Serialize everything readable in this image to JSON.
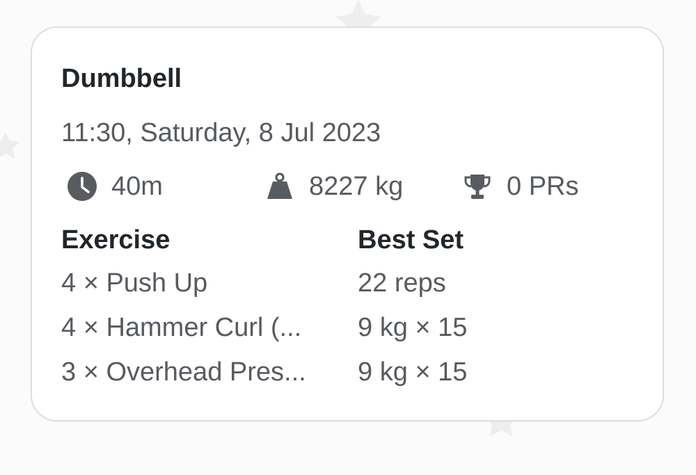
{
  "workout": {
    "title": "Dumbbell",
    "datetime": "11:30, Saturday, 8 Jul 2023"
  },
  "stats": {
    "duration": "40m",
    "volume": "8227 kg",
    "prs": "0 PRs"
  },
  "table": {
    "headers": {
      "exercise": "Exercise",
      "best_set": "Best Set"
    },
    "rows": [
      {
        "exercise": "4 × Push Up",
        "best_set": "22 reps"
      },
      {
        "exercise": "4 × Hammer Curl (...",
        "best_set": "9 kg × 15"
      },
      {
        "exercise": "3 × Overhead Pres...",
        "best_set": "9 kg × 15"
      }
    ]
  },
  "icons": {
    "duration": "clock-icon",
    "volume": "weight-icon",
    "prs": "trophy-icon"
  },
  "colors": {
    "title_text": "#22272b",
    "secondary_text": "#575b5f",
    "icon": "#585c60",
    "card_border": "#dedede",
    "background": "#fbfbfb"
  }
}
